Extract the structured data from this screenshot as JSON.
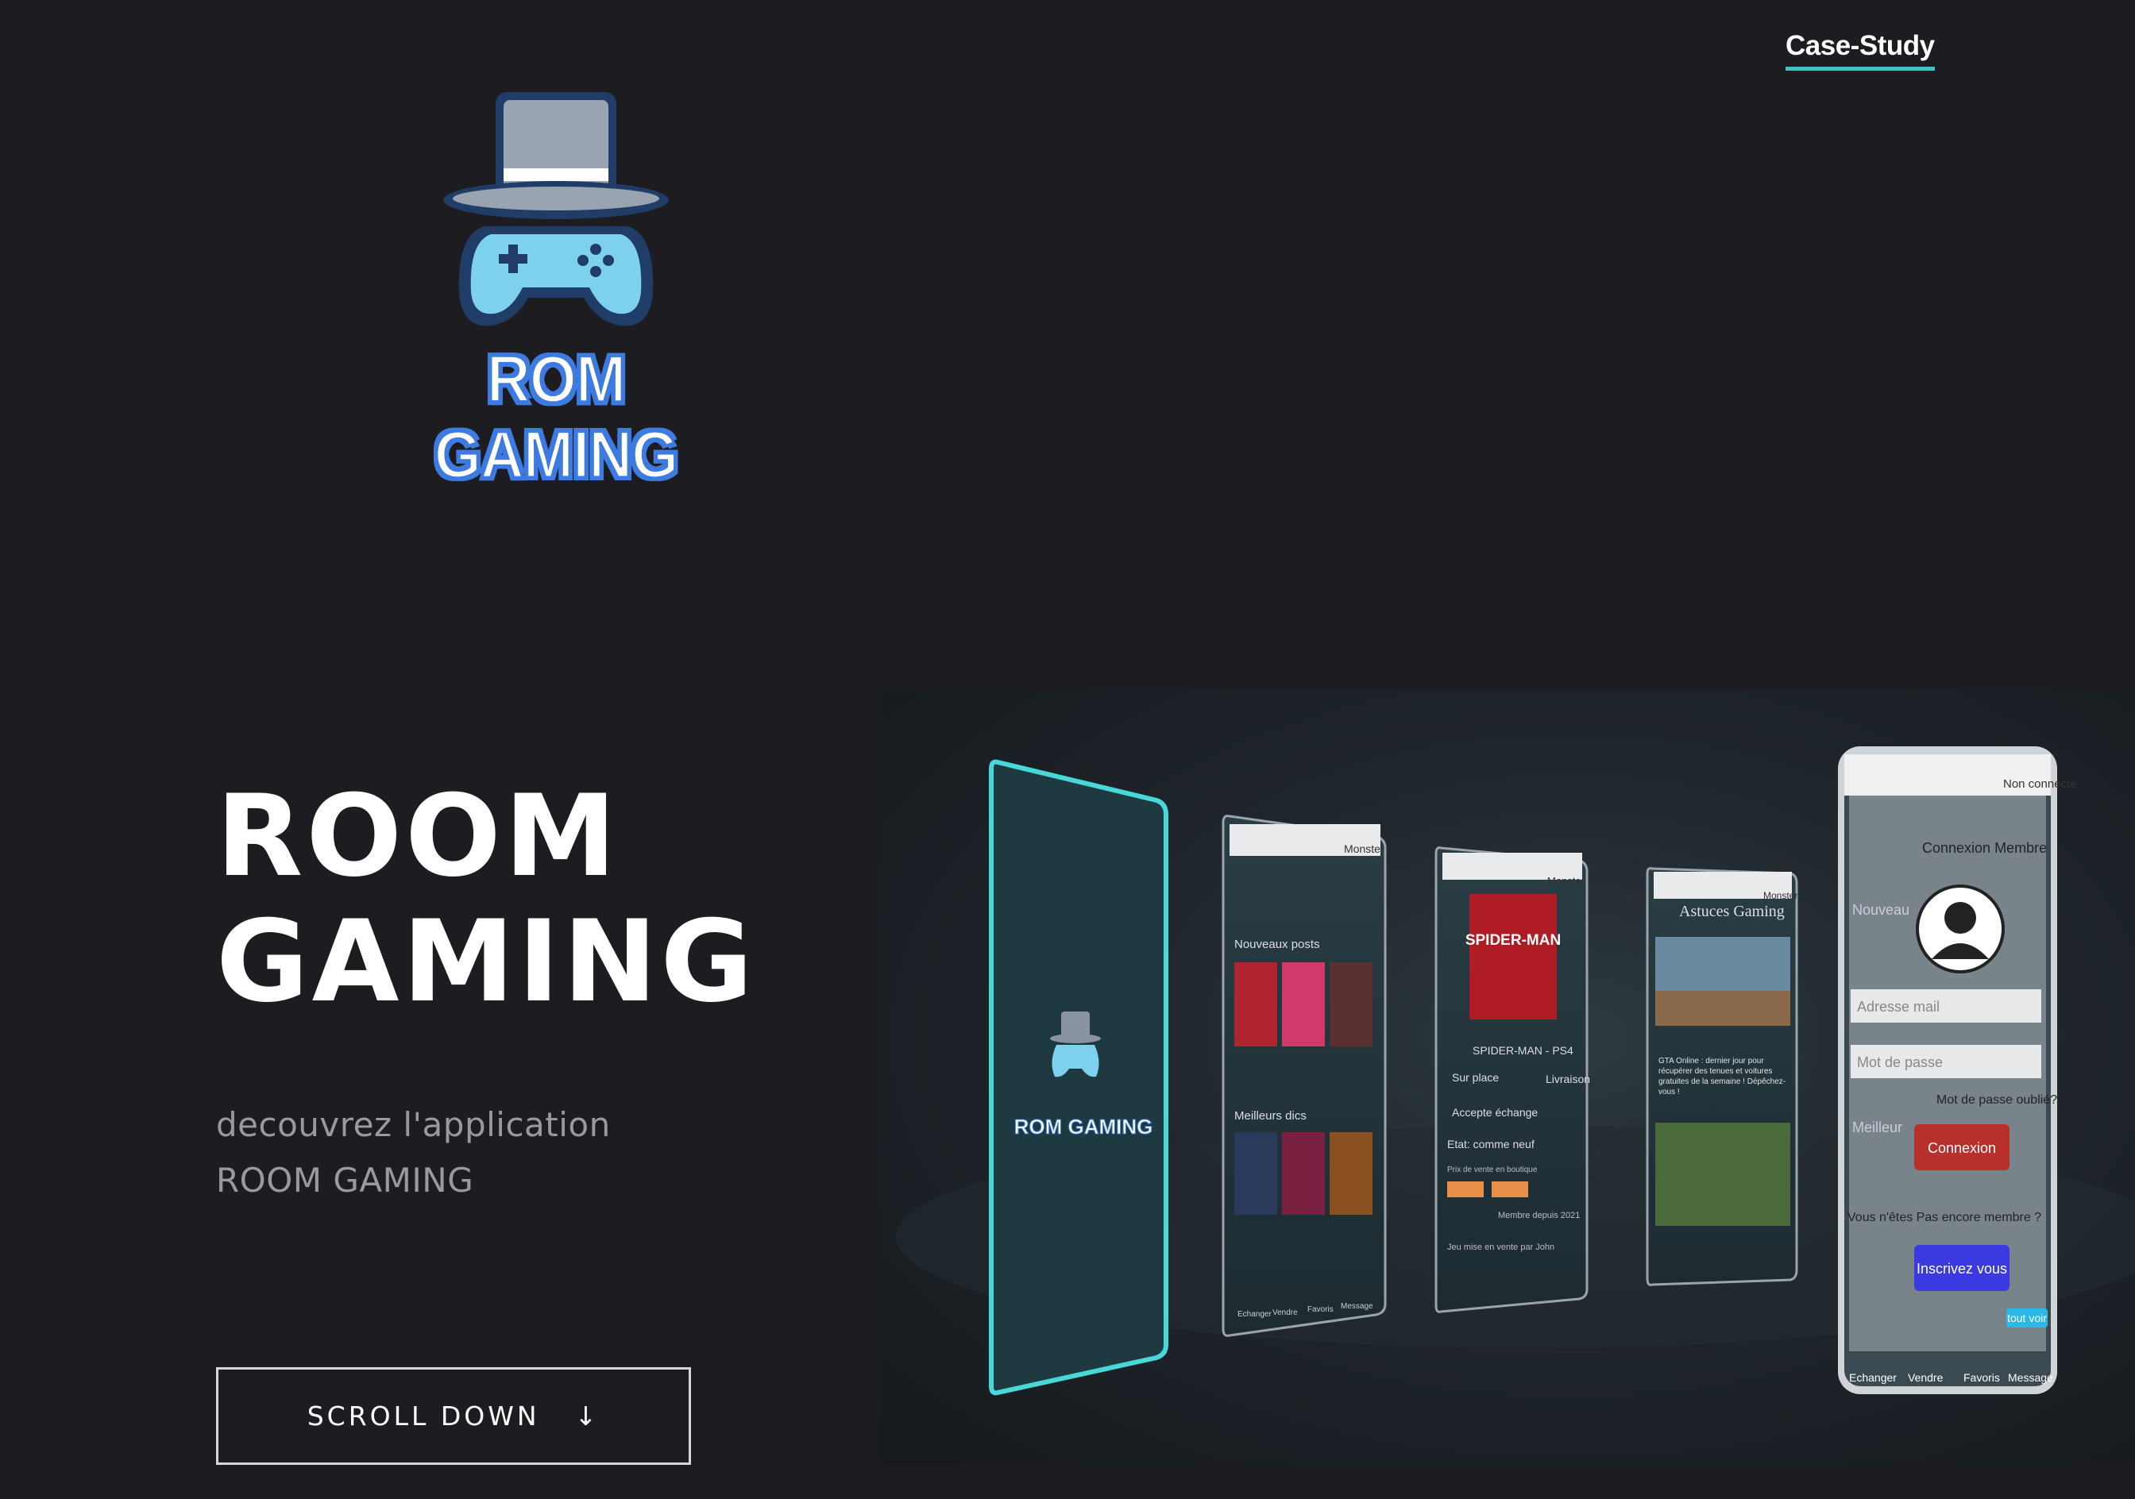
{
  "nav": {
    "case_study": "Case-Study"
  },
  "brand": {
    "logo_text": "ROM GAMING",
    "accent": "#42c1c4",
    "cyan": "#5ed0f0",
    "logo_blue": "#3d7be0"
  },
  "hero": {
    "title_line1": "ROOM",
    "title_line2": "GAMING",
    "tagline_line1": "decouvrez l'application",
    "tagline_line2": "ROOM GAMING",
    "scroll_label": "SCROLL DOWN",
    "scroll_icon": "arrow-down-icon"
  },
  "phones": {
    "splash_logo": "ROM GAMING",
    "home": {
      "header_user": "Monster",
      "section_new": "Nouveaux posts",
      "section_best": "Meilleurs dics",
      "nav": [
        "Echanger",
        "Vendre",
        "Favoris",
        "Message"
      ]
    },
    "product": {
      "header_user": "Monster",
      "title": "SPIDER-MAN - PS4",
      "cover_text": "SPIDER-MAN",
      "opt1": "Sur place",
      "opt2": "Livraison",
      "opt3": "Accepte échange",
      "state": "Etat: comme neuf",
      "price_label": "Prix de vente en boutique",
      "member": "Membre depuis 2021",
      "listing": "Jeu mise en vente par John"
    },
    "tips": {
      "header_user": "Monster",
      "title": "Astuces Gaming",
      "article": "GTA Online : dernier jour pour récupérer des tenues et voitures gratuites de la semaine ! Dépêchez-vous !"
    },
    "login": {
      "header_user": "Non connecté",
      "title": "Connexion Membre",
      "email_ph": "Adresse mail",
      "password_ph": "Mot de passe",
      "forgot": "Mot de passe oublié?",
      "connect_btn": "Connexion",
      "not_member": "Vous n'êtes Pas encore membre ?",
      "signup_btn": "Inscrivez vous",
      "see_all": "tout voir",
      "bg_new": "Nouveau",
      "bg_best": "Meilleur",
      "nav": [
        "Echanger",
        "Vendre",
        "Favoris",
        "Message"
      ]
    }
  }
}
